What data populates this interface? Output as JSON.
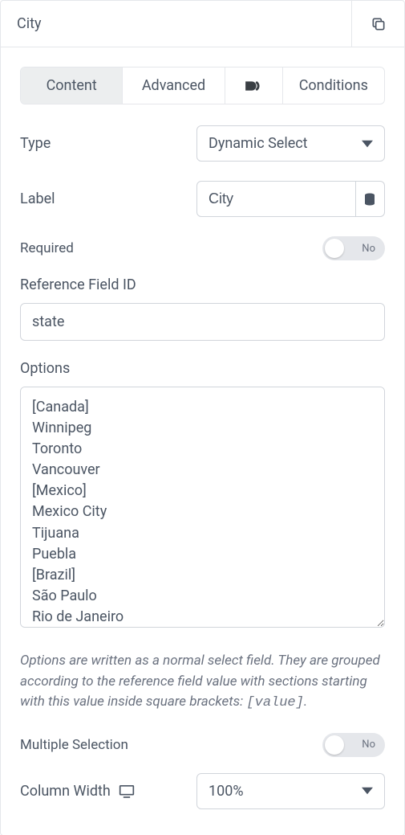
{
  "header": {
    "title": "City"
  },
  "tabs": {
    "content": "Content",
    "advanced": "Advanced",
    "conditions": "Conditions"
  },
  "fields": {
    "type_label": "Type",
    "type_value": "Dynamic Select",
    "label_label": "Label",
    "label_value": "City",
    "required_label": "Required",
    "required_value": "No",
    "reference_label": "Reference Field ID",
    "reference_value": "state",
    "options_label": "Options",
    "options_value": "[Canada]\nWinnipeg\nToronto\nVancouver\n[Mexico]\nMexico City\nTijuana\nPuebla\n[Brazil]\nSão Paulo\nRio de Janeiro\nBrasilia",
    "options_helper_pre": "Options are written as a normal select field. They are grouped according to the reference field value with sections starting with this value inside square brackets: ",
    "options_helper_code": "[value]",
    "options_helper_post": ".",
    "multiple_label": "Multiple Selection",
    "multiple_value": "No",
    "colwidth_label": "Column Width",
    "colwidth_value": "100%"
  }
}
